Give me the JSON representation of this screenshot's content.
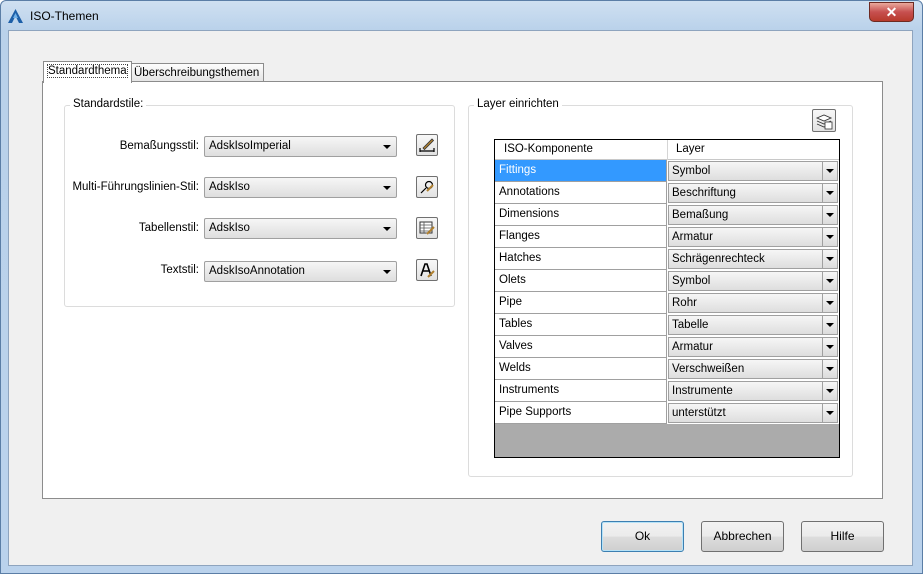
{
  "window": {
    "title": "ISO-Themen",
    "close_glyph": "✕"
  },
  "tabs": [
    {
      "label": "Standardthema",
      "active": true
    },
    {
      "label": "Überschreibungsthemen",
      "active": false
    }
  ],
  "standard_styles": {
    "title": "Standardstile:",
    "rows": [
      {
        "label": "Bemaßungsstil:",
        "value": "AdskIsoImperial",
        "icon": "dimension-style-edit-icon"
      },
      {
        "label": "Multi-Führungslinien-Stil:",
        "value": "AdskIso",
        "icon": "multileader-style-edit-icon"
      },
      {
        "label": "Tabellenstil:",
        "value": "AdskIso",
        "icon": "table-style-edit-icon"
      },
      {
        "label": "Textstil:",
        "value": "AdskIsoAnnotation",
        "icon": "text-style-edit-icon"
      }
    ]
  },
  "layer_setup": {
    "title": "Layer einrichten",
    "columns": {
      "component": "ISO-Komponente",
      "layer": "Layer"
    },
    "rows": [
      {
        "component": "Fittings",
        "layer": "Symbol",
        "selected": true
      },
      {
        "component": "Annotations",
        "layer": "Beschriftung"
      },
      {
        "component": "Dimensions",
        "layer": "Bemaßung"
      },
      {
        "component": "Flanges",
        "layer": "Armatur"
      },
      {
        "component": "Hatches",
        "layer": "Schrägenrechteck"
      },
      {
        "component": "Olets",
        "layer": "Symbol"
      },
      {
        "component": "Pipe",
        "layer": "Rohr"
      },
      {
        "component": "Tables",
        "layer": "Tabelle"
      },
      {
        "component": "Valves",
        "layer": "Armatur"
      },
      {
        "component": "Welds",
        "layer": "Verschweißen"
      },
      {
        "component": "Instruments",
        "layer": "Instrumente"
      },
      {
        "component": "Pipe Supports",
        "layer": "unterstützt"
      }
    ]
  },
  "buttons": {
    "ok": "Ok",
    "cancel": "Abbrechen",
    "help": "Hilfe"
  },
  "colors": {
    "selection": "#3399ff",
    "title_bar": "#b9d1ea",
    "close": "#c75050"
  }
}
